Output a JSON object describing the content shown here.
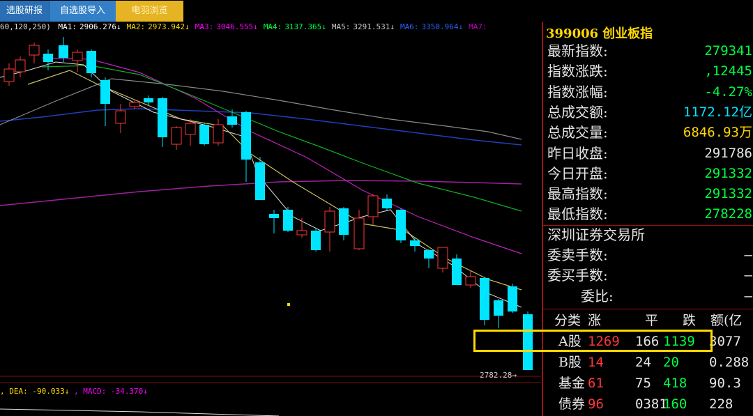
{
  "tabs": [
    "选股研报",
    "自选股导入",
    "电羽浏览"
  ],
  "ma_legend": {
    "params": "60,120,250)",
    "items": [
      {
        "label": "MA1:",
        "value": "2906.276↓",
        "color": "#ffffff"
      },
      {
        "label": "MA2:",
        "value": "2973.942↓",
        "color": "#ffd800"
      },
      {
        "label": "MA3:",
        "value": "3046.555↓",
        "color": "#ff00ff"
      },
      {
        "label": "MA4:",
        "value": "3137.365↓",
        "color": "#00ff40"
      },
      {
        "label": "MA5:",
        "value": "3291.531↓",
        "color": "#cccccc"
      },
      {
        "label": "MA6:",
        "value": "3350.964↓",
        "color": "#3060ff"
      },
      {
        "label": "MA7:",
        "value": "",
        "color": "#c000c0"
      }
    ]
  },
  "macd_legend": {
    "dea": ", DEA: -90.033↓",
    "macd": ", MACD: -34.370↓",
    "dea_color": "#ffd800",
    "macd_color": "#ff00ff"
  },
  "low_label": "2782.28",
  "panel": {
    "code": "399006",
    "name": "创业板指",
    "rows": [
      {
        "label": "最新指数:",
        "value": "279341",
        "cls": "g"
      },
      {
        "label": "指数涨跌:",
        "value": ",12445",
        "cls": "g"
      },
      {
        "label": "指数涨幅:",
        "value": "-4.27%",
        "cls": "g"
      },
      {
        "label": "总成交额:",
        "value": "1172.12亿",
        "cls": "c"
      },
      {
        "label": "总成交量:",
        "value": "6846.93万",
        "cls": "y"
      },
      {
        "label": "昨日收盘:",
        "value": "291786",
        "cls": "w"
      },
      {
        "label": "今日开盘:",
        "value": "291332",
        "cls": "g"
      },
      {
        "label": "最高指数:",
        "value": "291332",
        "cls": "g"
      },
      {
        "label": "最低指数:",
        "value": "278228",
        "cls": "g"
      },
      {
        "label": "深圳证券交易所",
        "value": "",
        "cls": "w"
      },
      {
        "label": "委卖手数:",
        "value": "—",
        "cls": "w"
      },
      {
        "label": "委买手数:",
        "value": "—",
        "cls": "w"
      },
      {
        "label": "委比:",
        "value": "—",
        "cls": "w"
      }
    ],
    "table": {
      "headers": [
        "分类",
        "涨",
        "平",
        "跌",
        "额(亿"
      ],
      "rows": [
        {
          "cat": "A股",
          "up": "1269",
          "flat": "166",
          "down": "1139",
          "amt": "3077"
        },
        {
          "cat": "B股",
          "up": "14",
          "flat": "24",
          "down": "20",
          "amt": "0.288"
        },
        {
          "cat": "基金",
          "up": "61",
          "flat": "75",
          "down": "418",
          "amt": "90.3"
        },
        {
          "cat": "债券",
          "up": "96",
          "flat": "0381",
          "down": "160",
          "amt": "228"
        }
      ]
    }
  },
  "colors": {
    "up_candle": "#ff3838",
    "down_candle": "#00e5ff",
    "panel_border": "#9a1414",
    "highlight": "#ffd800"
  }
}
